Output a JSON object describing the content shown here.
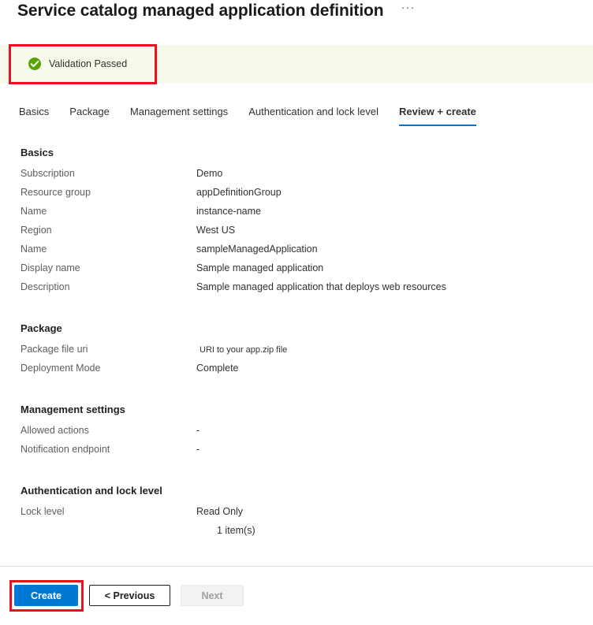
{
  "header": {
    "title": "Service catalog managed application definition",
    "more_menu": "···"
  },
  "validation": {
    "message": "Validation Passed",
    "icon": "check-circle-icon",
    "background_color": "#f5faeb",
    "icon_color": "#57a300",
    "annotation_color": "#e81123"
  },
  "tabs": [
    {
      "label": "Basics",
      "active": false
    },
    {
      "label": "Package",
      "active": false
    },
    {
      "label": "Management settings",
      "active": false
    },
    {
      "label": "Authentication and lock level",
      "active": false
    },
    {
      "label": "Review + create",
      "active": true
    }
  ],
  "sections": [
    {
      "heading": "Basics",
      "rows": [
        {
          "label": "Subscription",
          "value": "Demo"
        },
        {
          "label": "Resource group",
          "value": "appDefinitionGroup"
        },
        {
          "label": "Name",
          "value": "instance-name"
        },
        {
          "label": "Region",
          "value": "West US"
        },
        {
          "label": "Name",
          "value": "sampleManagedApplication"
        },
        {
          "label": "Display name",
          "value": "Sample managed application"
        },
        {
          "label": "Description",
          "value": "Sample managed application that deploys web resources"
        }
      ]
    },
    {
      "heading": "Package",
      "rows": [
        {
          "label": "Package file uri",
          "value": "URI to your app.zip file",
          "small": true
        },
        {
          "label": "Deployment Mode",
          "value": "Complete"
        }
      ]
    },
    {
      "heading": "Management settings",
      "rows": [
        {
          "label": "Allowed actions",
          "value": "-"
        },
        {
          "label": "Notification endpoint",
          "value": "-"
        }
      ]
    },
    {
      "heading": "Authentication and lock level",
      "rows": [
        {
          "label": "Lock level",
          "value": "Read Only"
        }
      ],
      "extra_values": [
        "1 item(s)"
      ]
    }
  ],
  "footer": {
    "create_label": "Create",
    "previous_label": "< Previous",
    "next_label": "Next",
    "next_disabled": true,
    "accent_color": "#0078d4"
  }
}
